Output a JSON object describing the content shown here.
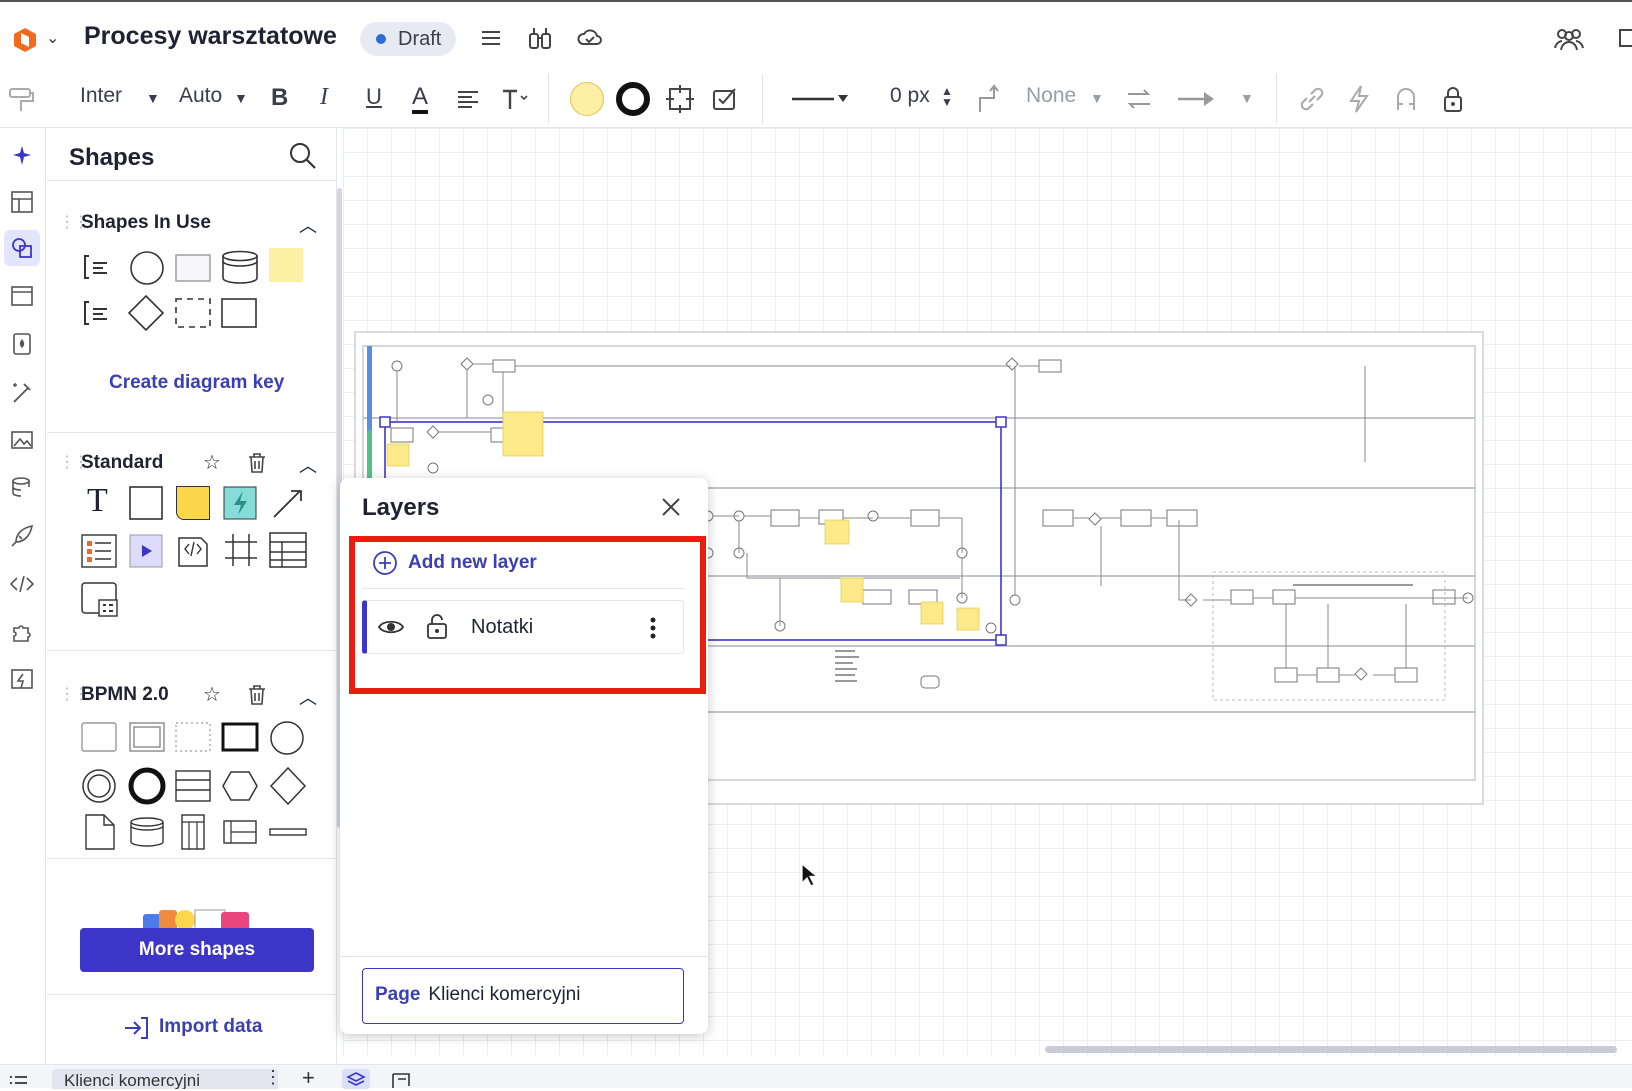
{
  "app": {
    "doc_title": "Procesy warsztatowe",
    "status_badge": "Draft"
  },
  "toolbar": {
    "font": "Inter",
    "font_size": "Auto",
    "bold": "B",
    "italic": "I",
    "underline": "U",
    "text_color": "A",
    "line_width": "0 px",
    "arrow_none": "None",
    "fill_color": "#fdf0a4"
  },
  "shapes_panel": {
    "title": "Shapes",
    "sections": {
      "in_use": "Shapes In Use",
      "create_key": "Create diagram key",
      "standard": "Standard",
      "standard_text_glyph": "T",
      "bpmn": "BPMN 2.0"
    },
    "more_shapes": "More shapes",
    "import_data": "Import data"
  },
  "layers_panel": {
    "title": "Layers",
    "add_layer": "Add new layer",
    "layers": [
      {
        "name": "Notatki",
        "visible": true,
        "locked": false
      }
    ],
    "page_label": "Page",
    "page_name": "Klienci komercyjni"
  },
  "bottom": {
    "page_tab": "Klienci komercyjni"
  },
  "colors": {
    "accent": "#3d35c8",
    "highlight": "#ec1c10",
    "sticky_note": "#fdf0a4"
  }
}
